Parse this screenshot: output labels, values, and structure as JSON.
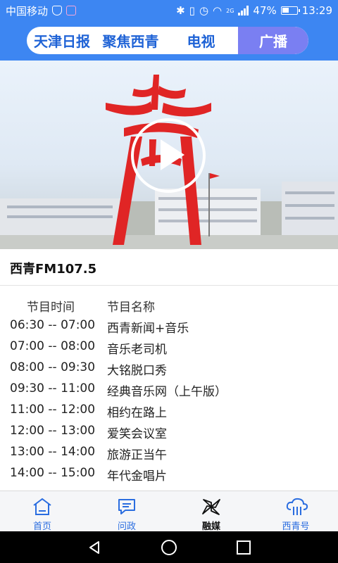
{
  "statusbar": {
    "carrier": "中国移动",
    "network": "2G",
    "battery": "47%",
    "battery_level": 0.47,
    "time": "13:29"
  },
  "tabs": [
    {
      "label": "天津日报"
    },
    {
      "label": "聚焦西青"
    },
    {
      "label": "电视"
    },
    {
      "label": "广播"
    }
  ],
  "station": {
    "title": "西青FM107.5"
  },
  "schedule": {
    "header_time": "节目时间",
    "header_name": "节目名称",
    "rows": [
      {
        "time": "06:30 -- 07:00",
        "name": "西青新闻+音乐"
      },
      {
        "time": "07:00 -- 08:00",
        "name": "音乐老司机"
      },
      {
        "time": "08:00 -- 09:30",
        "name": "大铭脱口秀"
      },
      {
        "time": "09:30 -- 11:00",
        "name": "经典音乐网（上午版）"
      },
      {
        "time": "11:00 -- 12:00",
        "name": "相约在路上"
      },
      {
        "time": "12:00 -- 13:00",
        "name": "爱笑会议室"
      },
      {
        "time": "13:00 -- 14:00",
        "name": "旅游正当午"
      },
      {
        "time": "14:00 -- 15:00",
        "name": "年代金唱片"
      }
    ]
  },
  "bottom_nav": [
    {
      "label": "首页"
    },
    {
      "label": "问政"
    },
    {
      "label": "融媒"
    },
    {
      "label": "西青号"
    }
  ],
  "colors": {
    "brand_blue": "#3d86f2",
    "active_tab": "#7a7ff2",
    "sculpture_red": "#e02525"
  }
}
